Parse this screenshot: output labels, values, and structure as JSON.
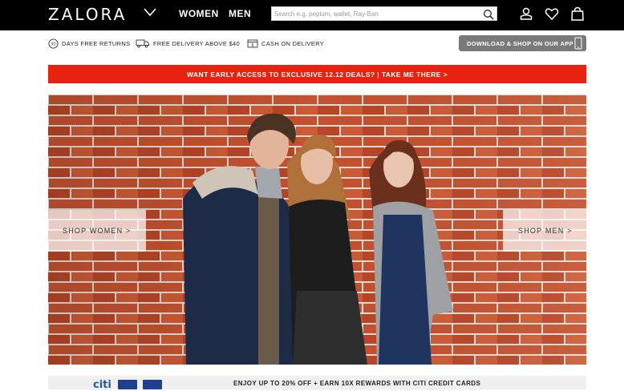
{
  "header": {
    "logo": "ZALORA",
    "nav": {
      "women": "WOMEN",
      "men": "MEN"
    },
    "search": {
      "placeholder": "Search e.g. peplum, wallet, Ray-Ban",
      "value": ""
    },
    "icons": [
      "search-icon",
      "account-icon",
      "wishlist-heart-icon",
      "shopping-bag-icon"
    ]
  },
  "infobar": {
    "returns_badge": "30",
    "returns": "DAYS FREE RETURNS",
    "delivery": "FREE DELIVERY ABOVE $40",
    "cod": "CASH ON DELIVERY",
    "app_button": "DOWNLOAD & SHOP ON OUR APP"
  },
  "promo": {
    "text": "WANT EARLY ACCESS TO EXCLUSIVE 12.12 DEALS? | TAKE ME THERE >"
  },
  "hero": {
    "shop_women": "SHOP WOMEN >",
    "shop_men": "SHOP MEN >"
  },
  "citi": {
    "logo": "citi",
    "text": "ENJOY UP TO 20% OFF + EARN 10X REWARDS WITH CITI CREDIT CARDS"
  },
  "colors": {
    "header_bg": "#000000",
    "promo_red": "#e8220f",
    "app_button_grey": "#7a7a7a",
    "brick": "#b9492c"
  }
}
